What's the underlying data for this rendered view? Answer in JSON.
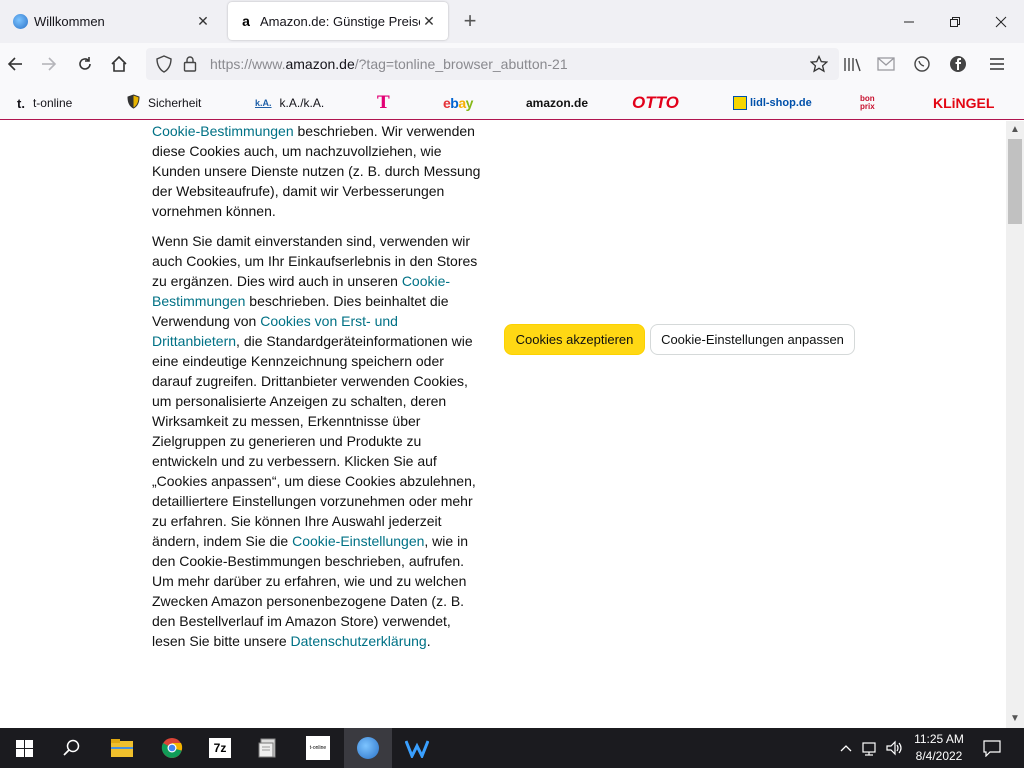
{
  "browser": {
    "tabs": [
      {
        "title": "Willkommen",
        "active": false
      },
      {
        "title": "Amazon.de: Günstige Preise für",
        "active": true
      }
    ],
    "url_prefix": "https://www.",
    "url_domain": "amazon.de",
    "url_suffix": "/?tag=tonline_browser_abutton-21"
  },
  "bookmarks": [
    {
      "label": "t-online",
      "icon": "t-online-icon"
    },
    {
      "label": "Sicherheit",
      "icon": "shield-icon"
    },
    {
      "label": "k.A./k.A.",
      "icon": "ka-icon"
    },
    {
      "label": "",
      "icon": "telekom-icon"
    },
    {
      "label": "ebay",
      "icon": "ebay-logo"
    },
    {
      "label": "amazon.de",
      "icon": "amazon-logo"
    },
    {
      "label": "OTTO",
      "icon": "otto-logo"
    },
    {
      "label": "lidl-shop.de",
      "icon": "lidl-icon"
    },
    {
      "label": "",
      "icon": "bonprix-logo"
    },
    {
      "label": "KLiNGEL",
      "icon": "klingel-logo"
    }
  ],
  "content": {
    "p1_link": "Cookie-Bestimmungen",
    "p1_rest": " beschrieben. Wir verwenden diese Cookies auch, um nachzuvollziehen, wie Kunden unsere Dienste nutzen (z. B. durch Messung der Websiteaufrufe), damit wir Verbesserungen vornehmen können.",
    "p2_a": "Wenn Sie damit einverstanden sind, verwenden wir auch Cookies, um Ihr Einkaufserlebnis in den Stores zu ergänzen. Dies wird auch in unseren ",
    "p2_link1": "Cookie-Bestimmungen",
    "p2_b": " beschrieben. Dies beinhaltet die Verwendung von ",
    "p2_link2": "Cookies von Erst- und Drittanbietern",
    "p2_c": ", die Standardgeräteinformationen wie eine eindeutige Kennzeichnung speichern oder darauf zugreifen. Drittanbieter verwenden Cookies, um personalisierte Anzeigen zu schalten, deren Wirksamkeit zu messen, Erkenntnisse über Zielgruppen zu generieren und Produkte zu entwickeln und zu verbessern. Klicken Sie auf „Cookies anpassen“, um diese Cookies abzulehnen, detailliertere Einstellungen vorzunehmen oder mehr zu erfahren. Sie können Ihre Auswahl jederzeit ändern, indem Sie die ",
    "p2_link3": "Cookie-Einstellungen",
    "p2_d": ", wie in den Cookie-Bestimmungen beschrieben, aufrufen. Um mehr darüber zu erfahren, wie und zu welchen Zwecken Amazon personenbezogene Daten (z. B. den Bestellverlauf im Amazon Store) verwendet, lesen Sie bitte unsere ",
    "p2_link4": "Datenschutzerklärung",
    "p2_e": ".",
    "accept_label": "Cookies akzeptieren",
    "customize_label": "Cookie-Einstellungen anpassen"
  },
  "taskbar": {
    "time": "11:25 AM",
    "date": "8/4/2022"
  },
  "colors": {
    "accept_button": "#ffd814",
    "link": "#007185",
    "taskbar": "#1b1b1f"
  }
}
